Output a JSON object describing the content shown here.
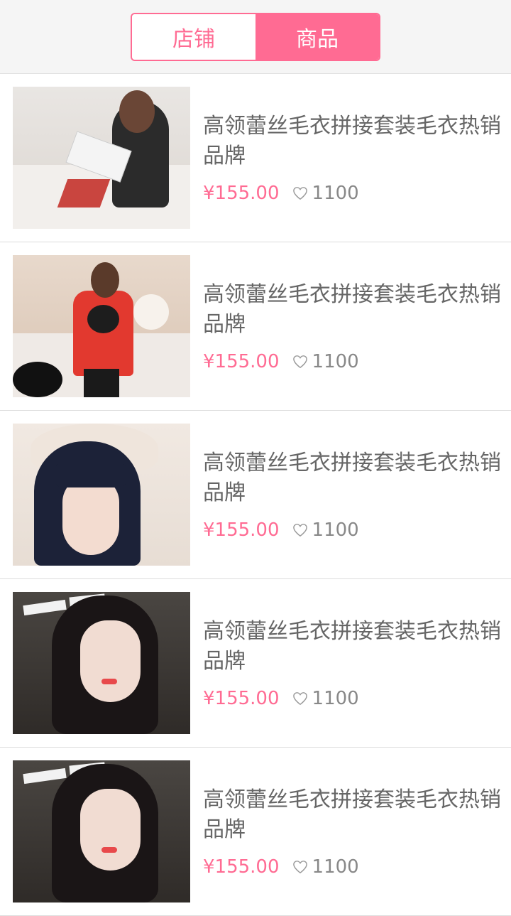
{
  "colors": {
    "accent": "#ff6b93",
    "text": "#666666",
    "muted": "#888888"
  },
  "tabs": {
    "shop_label": "店铺",
    "product_label": "商品",
    "active": "product"
  },
  "products": [
    {
      "title": "高领蕾丝毛衣拼接套装毛衣热销品牌",
      "price": "¥155.00",
      "likes": "1100",
      "image": "woman-reading-magazine"
    },
    {
      "title": "高领蕾丝毛衣拼接套装毛衣热销品牌",
      "price": "¥155.00",
      "likes": "1100",
      "image": "woman-red-jacket"
    },
    {
      "title": "高领蕾丝毛衣拼接套装毛衣热销品牌",
      "price": "¥155.00",
      "likes": "1100",
      "image": "girl-white-beret"
    },
    {
      "title": "高领蕾丝毛衣拼接套装毛衣热销品牌",
      "price": "¥155.00",
      "likes": "1100",
      "image": "girl-long-hair-selfie"
    },
    {
      "title": "高领蕾丝毛衣拼接套装毛衣热销品牌",
      "price": "¥155.00",
      "likes": "1100",
      "image": "girl-long-hair-selfie"
    }
  ]
}
